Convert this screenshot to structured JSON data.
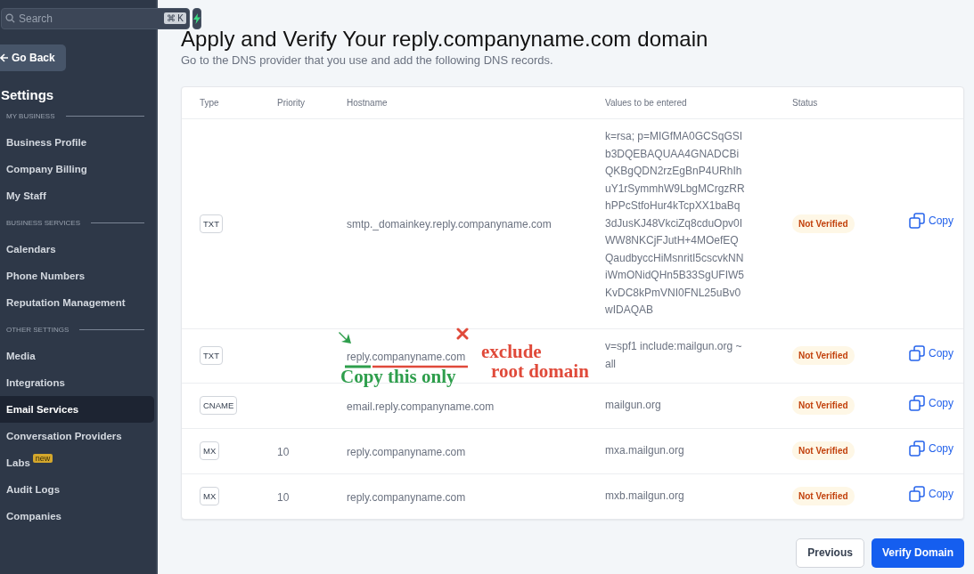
{
  "sidebar": {
    "search": {
      "placeholder": "Search",
      "shortcut": "⌘ K"
    },
    "back_button": "Go Back",
    "title": "Settings",
    "sections": [
      {
        "heading": "MY BUSINESS",
        "items": [
          {
            "label": "Business Profile",
            "selected": false
          },
          {
            "label": "Company Billing",
            "selected": false
          },
          {
            "label": "My Staff",
            "selected": false
          }
        ]
      },
      {
        "heading": "BUSINESS SERVICES",
        "items": [
          {
            "label": "Calendars",
            "selected": false
          },
          {
            "label": "Phone Numbers",
            "selected": false
          },
          {
            "label": "Reputation Management",
            "selected": false
          }
        ]
      },
      {
        "heading": "OTHER SETTINGS",
        "items": [
          {
            "label": "Media",
            "selected": false
          },
          {
            "label": "Integrations",
            "selected": false
          },
          {
            "label": "Email Services",
            "selected": true
          },
          {
            "label": "Conversation Providers",
            "selected": false
          },
          {
            "label": "Labs",
            "selected": false,
            "badge": "new"
          },
          {
            "label": "Audit Logs",
            "selected": false
          },
          {
            "label": "Companies",
            "selected": false
          }
        ]
      }
    ]
  },
  "title": "Apply and Verify Your reply.companyname.com domain",
  "subtitle": "Go to the DNS provider that you use and add the following DNS records.",
  "table": {
    "columns": [
      "Type",
      "Priority",
      "Hostname",
      "Values to be entered",
      "Status"
    ],
    "rows": [
      {
        "type": "TXT",
        "priority": "",
        "hostname": "smtp._domainkey.reply.companyname.com",
        "value": "k=rsa; p=MIGfMA0GCSqGSIb3DQEBAQUAA4GNADCBiQKBgQDN2rzEgBnP4URhIhuY1rSymmhW9LbgMCrgzRRhPPcStfoHur4kTcpXX1baBq3dJusKJ48VkciZq8cduOpv0IWW8NKCjFJutH+4MOefEQQaudbyccHiMsnritI5cscvkNNiWmONidQHn5B33SgUFIW5KvDC8kPmVNI0FNL25uBv0wIDAQAB",
        "status": "Not Verified",
        "copy": "Copy"
      },
      {
        "type": "TXT",
        "priority": "",
        "hostname": "reply.companyname.com",
        "value": "v=spf1 include:mailgun.org ~all",
        "status": "Not Verified",
        "copy": "Copy",
        "annotation": {
          "keep": "Copy this only",
          "exclude": [
            "exclude",
            "root domain"
          ]
        }
      },
      {
        "type": "CNAME",
        "priority": "",
        "hostname": "email.reply.companyname.com",
        "value": "mailgun.org",
        "status": "Not Verified",
        "copy": "Copy"
      },
      {
        "type": "MX",
        "priority": "10",
        "hostname": "reply.companyname.com",
        "value": "mxa.mailgun.org",
        "status": "Not Verified",
        "copy": "Copy"
      },
      {
        "type": "MX",
        "priority": "10",
        "hostname": "reply.companyname.com",
        "value": "mxb.mailgun.org",
        "status": "Not Verified",
        "copy": "Copy"
      }
    ]
  },
  "buttons": {
    "previous": "Previous",
    "verify": "Verify Domain"
  }
}
